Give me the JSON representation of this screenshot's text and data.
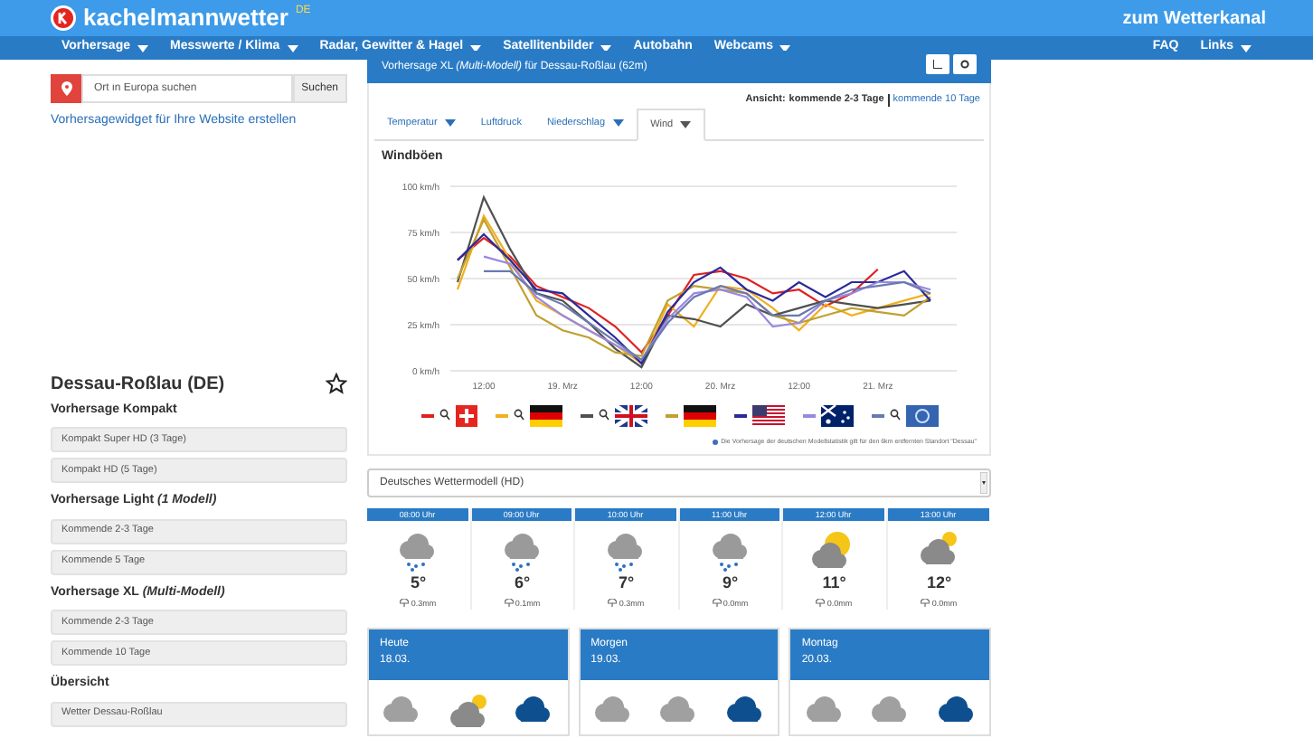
{
  "header": {
    "brand": "kachelmannwetter",
    "brand_suffix": "DE",
    "channel_link": "zum Wetterkanal"
  },
  "nav": {
    "left": [
      {
        "label": "Vorhersage",
        "dropdown": true
      },
      {
        "label": "Messwerte / Klima",
        "dropdown": true
      },
      {
        "label": "Radar, Gewitter & Hagel",
        "dropdown": true
      },
      {
        "label": "Satellitenbilder",
        "dropdown": true
      },
      {
        "label": "Autobahn",
        "dropdown": false
      },
      {
        "label": "Webcams",
        "dropdown": true
      }
    ],
    "right": [
      {
        "label": "FAQ",
        "dropdown": false
      },
      {
        "label": "Links",
        "dropdown": true
      }
    ]
  },
  "search": {
    "placeholder": "Ort in Europa suchen",
    "button": "Suchen"
  },
  "widget_link": "Vorhersagewidget für Ihre Website erstellen",
  "location": {
    "title": "Dessau-Roßlau (DE)",
    "favorite": false
  },
  "sidebar": [
    {
      "heading": "Vorhersage Kompakt",
      "items": [
        "Kompakt Super HD (3 Tage)",
        "Kompakt HD (5 Tage)"
      ]
    },
    {
      "heading": "Vorhersage Light",
      "note": "(1 Modell)",
      "items": [
        "Kommende 2-3 Tage",
        "Kommende 5 Tage"
      ]
    },
    {
      "heading": "Vorhersage XL",
      "note": "(Multi-Modell)",
      "items": [
        "Kommende 2-3 Tage",
        "Kommende 10 Tage"
      ]
    },
    {
      "heading": "Übersicht",
      "items": [
        "Wetter Dessau-Roßlau"
      ]
    }
  ],
  "panel": {
    "title": "Vorhersage XL *(Multi-Modell)* für Dessau-Roßlau (62m)",
    "view_label": "Ansicht:",
    "view_current": "kommende 2-3 Tage",
    "view_other": "kommende 10 Tage"
  },
  "tabs": [
    {
      "label": "Temperatur",
      "dropdown": true,
      "selected": false
    },
    {
      "label": "Luftdruck",
      "dropdown": false,
      "selected": false
    },
    {
      "label": "Niederschlag",
      "dropdown": true,
      "selected": false
    },
    {
      "label": "Wind",
      "dropdown": true,
      "selected": true
    }
  ],
  "chart_data": {
    "type": "line",
    "title": "Windböen",
    "grid": true,
    "categories": [
      null,
      "12:00",
      null,
      null,
      "19. Mrz",
      null,
      null,
      "12:00",
      null,
      null,
      "20. Mrz",
      null,
      null,
      "12:00",
      null,
      null,
      "21. Mrz",
      null,
      null
    ],
    "ylim": [
      0,
      100
    ],
    "yticks": [
      {
        "value": 0,
        "label": "0 km/h"
      },
      {
        "value": 25,
        "label": "25 km/h"
      },
      {
        "value": 50,
        "label": "50 km/h"
      },
      {
        "value": 75,
        "label": "75 km/h"
      },
      {
        "value": 100,
        "label": "100 km/h"
      }
    ],
    "series": [
      {
        "color": "#e02020",
        "values": [
          60,
          72,
          62,
          46,
          40,
          34,
          24,
          10,
          30,
          52,
          54,
          50,
          42,
          44,
          35,
          42,
          55,
          null,
          null
        ]
      },
      {
        "color": "#f0b020",
        "values": [
          44,
          84,
          60,
          38,
          30,
          22,
          14,
          4,
          36,
          24,
          46,
          44,
          34,
          22,
          36,
          30,
          34,
          38,
          42
        ]
      },
      {
        "color": "#505050",
        "values": [
          48,
          94,
          66,
          42,
          38,
          26,
          12,
          2,
          30,
          28,
          24,
          36,
          30,
          34,
          38,
          36,
          34,
          36,
          38
        ]
      },
      {
        "color": "#c0a030",
        "values": [
          50,
          82,
          56,
          30,
          22,
          18,
          10,
          8,
          38,
          46,
          44,
          42,
          30,
          26,
          30,
          34,
          32,
          30,
          40
        ]
      },
      {
        "color": "#2a2a9a",
        "values": [
          60,
          74,
          60,
          44,
          42,
          30,
          18,
          4,
          32,
          48,
          56,
          44,
          38,
          48,
          40,
          48,
          48,
          54,
          38
        ]
      },
      {
        "color": "#9a88e0",
        "values": [
          null,
          62,
          58,
          40,
          30,
          22,
          14,
          6,
          28,
          42,
          44,
          40,
          24,
          26,
          38,
          42,
          48,
          48,
          44
        ]
      },
      {
        "color": "#6a7ab0",
        "values": [
          null,
          54,
          54,
          42,
          36,
          26,
          16,
          6,
          26,
          40,
          46,
          42,
          30,
          30,
          38,
          44,
          46,
          48,
          42
        ]
      }
    ]
  },
  "legend": [
    {
      "color": "#e02020",
      "kind": "swiss",
      "mos": true
    },
    {
      "color": "#f0b020",
      "kind": "german",
      "mos": true
    },
    {
      "color": "#505050",
      "kind": "uk",
      "mos": true
    },
    {
      "color": "#c0a030",
      "kind": "german",
      "mos": false
    },
    {
      "color": "#2a2a9a",
      "kind": "usa",
      "mos": false
    },
    {
      "color": "#9a88e0",
      "kind": "australia",
      "mos": false
    },
    {
      "color": "#6a7ab0",
      "kind": "europe",
      "mos": true
    }
  ],
  "footnote": "Die Vorhersage der deutschen Modellstatistik gilt für den 6km entfernten Standort \"Dessau\"",
  "model_select": {
    "value": "Deutsches Wettermodell (HD)"
  },
  "hours": [
    {
      "time": "08:00 Uhr",
      "kind": "rain",
      "temp": "5°",
      "precip": "0.3mm"
    },
    {
      "time": "09:00 Uhr",
      "kind": "rain",
      "temp": "6°",
      "precip": "0.1mm"
    },
    {
      "time": "10:00 Uhr",
      "kind": "rain",
      "temp": "7°",
      "precip": "0.3mm"
    },
    {
      "time": "11:00 Uhr",
      "kind": "rain",
      "temp": "9°",
      "precip": "0.0mm"
    },
    {
      "time": "12:00 Uhr",
      "kind": "sunny",
      "temp": "11°",
      "precip": "0.0mm"
    },
    {
      "time": "13:00 Uhr",
      "kind": "partly",
      "temp": "12°",
      "precip": "0.0mm"
    }
  ],
  "days": [
    {
      "day": "Heute",
      "date": "18.03.",
      "icons": [
        {
          "kind": "cloudy"
        },
        {
          "kind": "partly"
        },
        {
          "kind": "heavy"
        }
      ]
    },
    {
      "day": "Morgen",
      "date": "19.03.",
      "icons": [
        {
          "kind": "cloudy"
        },
        {
          "kind": "cloudy"
        },
        {
          "kind": "heavy"
        }
      ]
    },
    {
      "day": "Montag",
      "date": "20.03.",
      "icons": [
        {
          "kind": "cloudy"
        },
        {
          "kind": "cloudy"
        },
        {
          "kind": "heavy"
        }
      ]
    }
  ]
}
